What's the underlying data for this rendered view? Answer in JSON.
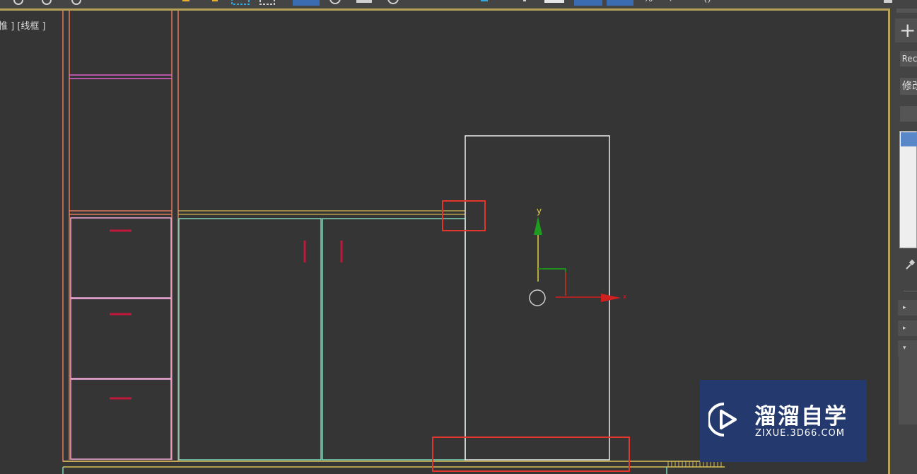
{
  "app": "3ds Max",
  "viewport": {
    "label": "惟 ] [线框 ]",
    "gizmo_axes": {
      "y": "y",
      "x": "x"
    }
  },
  "toolbar": {
    "icons": [
      "link-icon",
      "unlink-icon",
      "bind-icon",
      "select-icon",
      "select-region-icon",
      "window-crossing-icon",
      "move-icon",
      "rotate-icon",
      "scale-icon",
      "placement-icon",
      "snaps-icon",
      "angle-snap-icon",
      "percent-snap-icon",
      "spinner-snap-icon",
      "edit-named-selection-icon",
      "mirror-icon",
      "align-icon"
    ]
  },
  "command_panel": {
    "create_label": "+",
    "object_name": "Rec",
    "modifier_list": "修改",
    "sections": [
      "▸",
      "▸",
      "▾"
    ]
  },
  "annotations": {
    "highlight_color": "#e0362c"
  },
  "watermark": {
    "title": "溜溜自学",
    "url": "ZIXUE.3D66.COM"
  },
  "colors": {
    "viewport_bg": "#353535",
    "active_border": "#b7a25a",
    "cabinet_orange": "#e07a5f",
    "drawer_pink": "#f0a8d8",
    "door_teal": "#7fd3b8",
    "handle_red": "#c0183a",
    "panel_white": "#ececec",
    "gizmo_y": "#1f9b1f",
    "gizmo_x": "#d02020"
  }
}
